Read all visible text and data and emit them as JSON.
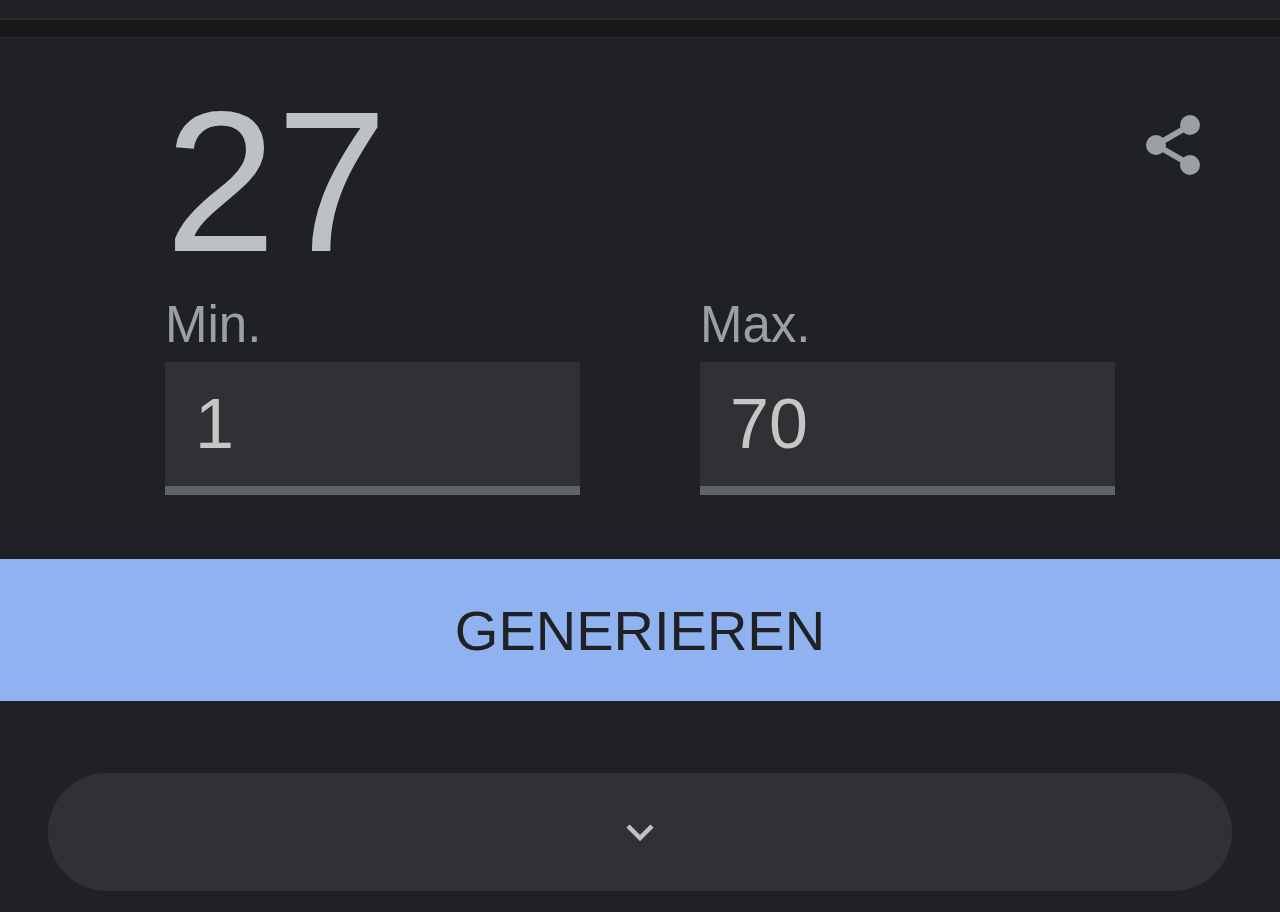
{
  "result": "27",
  "range_fields": [
    {
      "label": "Min.",
      "value": "1"
    },
    {
      "label": "Max.",
      "value": "70"
    }
  ],
  "generate_button": {
    "label": "GENERIEREN"
  },
  "expand_bar": {
    "expanded": false
  }
}
